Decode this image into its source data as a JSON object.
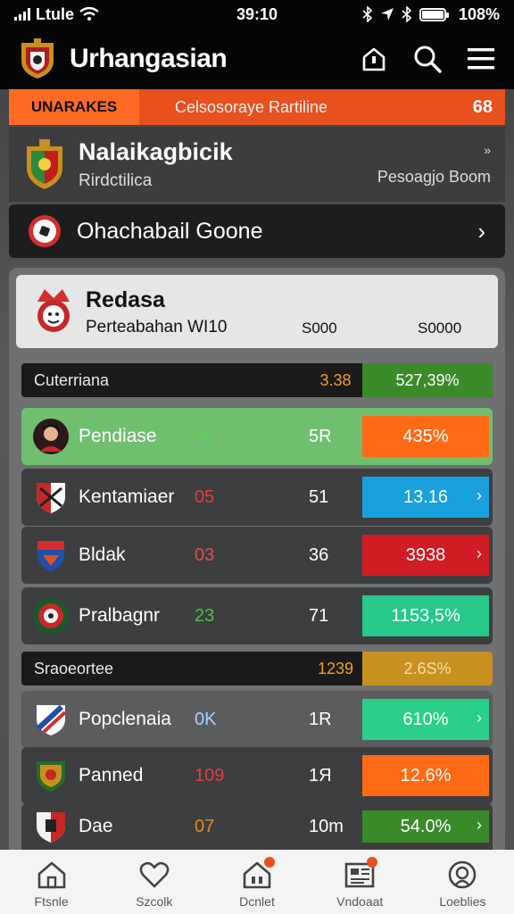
{
  "status_bar": {
    "carrier": "Ltule",
    "time": "39:10",
    "battery": "108%"
  },
  "header": {
    "title": "Urhangasian",
    "icons": [
      "home-icon",
      "search-icon",
      "menu-icon"
    ]
  },
  "strip": {
    "left": "UNARAKES",
    "middle": "Celsosoraye Rartiline",
    "right": "68"
  },
  "team": {
    "name": "Nalaikagbicik",
    "subtitle": "Rirdctilica",
    "right_text": "Pesoagjo Boom",
    "chevron": "»"
  },
  "game": {
    "label": "Ohachabail Goone",
    "chevron": "›"
  },
  "league": {
    "name": "Redasa",
    "subtitle": "Perteabahan WI10",
    "col1": "S000",
    "col2": "S0000"
  },
  "sections": [
    {
      "label": "Cuterriana",
      "num": "3.38",
      "pct": "527,39%",
      "pct_color": "#3a8a2a",
      "pct_text": "#ffffff"
    },
    {
      "label": "Sraoeortee",
      "num": "1239",
      "pct": "2.6S%",
      "pct_color": "#c8901e",
      "pct_text": "#f4e2b0"
    }
  ],
  "rows": [
    {
      "name": "Pendiase",
      "score": "00",
      "score_color": "#5fcf5f",
      "pts": "5R",
      "pct": "435%",
      "pct_color": "#ff6a14",
      "arrow": "",
      "row_color": "#6fbf6f",
      "name_color": "#ffffff"
    },
    {
      "name": "Kentamiaer",
      "score": "05",
      "score_color": "#e04040",
      "pts": "51",
      "pct": "13.16",
      "pct_color": "#1aa0dc",
      "arrow": "›",
      "row_color": "#3c3e40",
      "name_color": "#ffffff"
    },
    {
      "name": "Bldak",
      "score": "03",
      "score_color": "#e05050",
      "pts": "36",
      "pct": "3938",
      "pct_color": "#d01c24",
      "arrow": "›",
      "row_color": "#3c3e40",
      "name_color": "#ffffff"
    },
    {
      "name": "Pralbagnr",
      "score": "23",
      "score_color": "#4cc04c",
      "pts": "71",
      "pct": "1153,5%",
      "pct_color": "#26c98a",
      "arrow": "",
      "row_color": "#3c3e40",
      "name_color": "#ffffff"
    },
    {
      "name": "Popclenaia",
      "score": "0K",
      "score_color": "#a8d0ff",
      "pts": "1R",
      "pct": "610%",
      "pct_color": "#2ad08a",
      "arrow": "›",
      "row_color": "#5a5c5e",
      "name_color": "#ffffff"
    },
    {
      "name": "Panned",
      "score": "109",
      "score_color": "#e04040",
      "pts": "1Я",
      "pct": "12.6%",
      "pct_color": "#ff6a14",
      "arrow": "",
      "row_color": "#3c3e40",
      "name_color": "#ffffff"
    },
    {
      "name": "Dae",
      "score": "07",
      "score_color": "#e08a20",
      "pts": "10m",
      "pct": "54.0%",
      "pct_color": "#3a8a2a",
      "arrow": "›",
      "row_color": "#3c3e40",
      "name_color": "#ffffff"
    }
  ],
  "nav": [
    {
      "label": "Ftsnle",
      "icon": "home-icon"
    },
    {
      "label": "Szcolk",
      "icon": "heart-icon"
    },
    {
      "label": "Dcnlet",
      "icon": "notification-home-icon"
    },
    {
      "label": "Vndoaat",
      "icon": "news-icon"
    },
    {
      "label": "Loeblies",
      "icon": "profile-icon"
    }
  ]
}
